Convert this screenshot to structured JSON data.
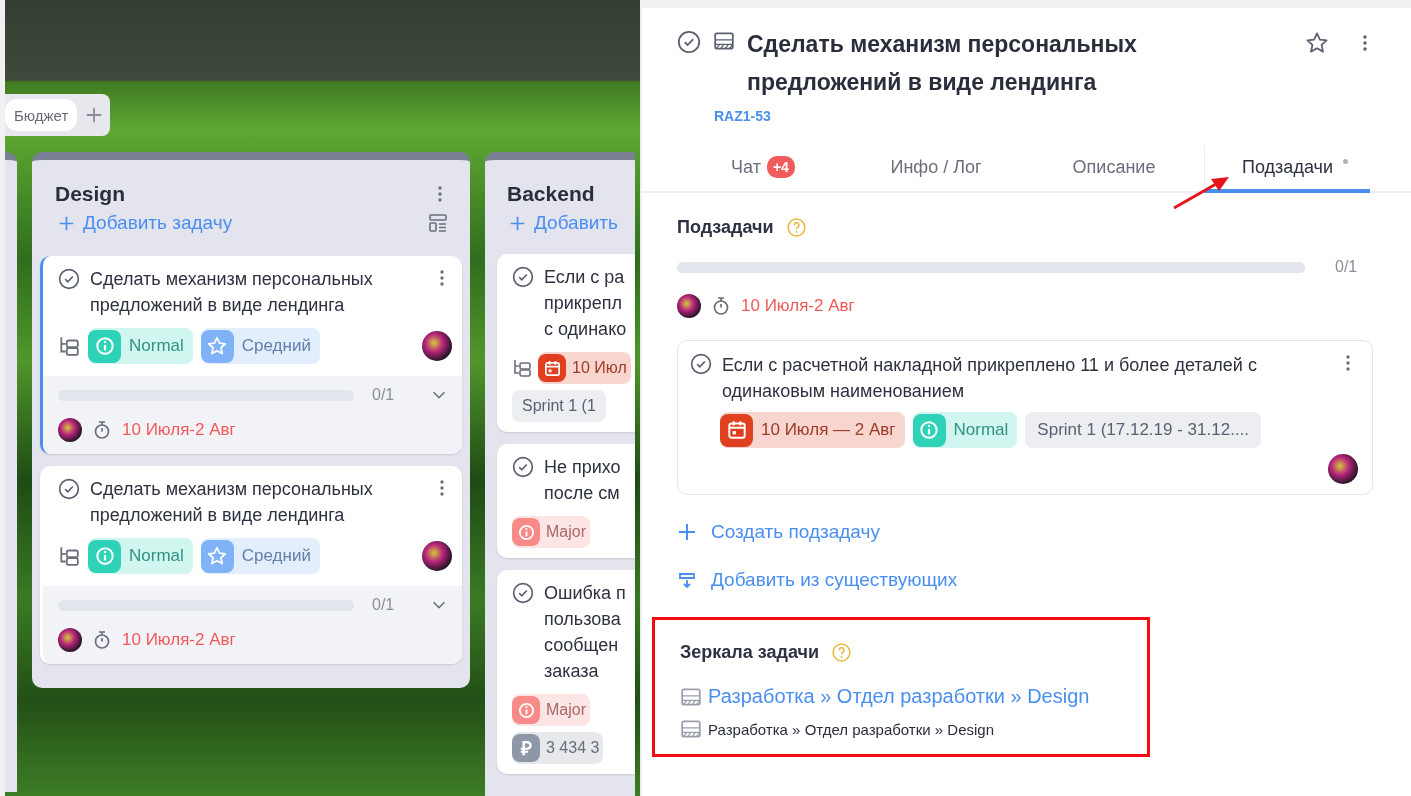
{
  "board": {
    "tabs": [
      {
        "label": "Бюджет",
        "selected": true
      }
    ],
    "columns": [
      {
        "kind": "partial"
      },
      {
        "kind": "full",
        "title": "Design",
        "add_label": "Добавить задачу",
        "cards": [
          {
            "title": "Сделать механизм персональных предложений в виде лендинга",
            "selected": true,
            "has_subtasks": true,
            "assignee": true,
            "tags": [
              {
                "kind": "priority",
                "label": "Normal",
                "color": "#2ed3b7"
              },
              {
                "kind": "importance",
                "label": "Средний",
                "color": "#7fb2f7"
              }
            ],
            "subtasks": {
              "level": 0,
              "reading": "0/1",
              "expanded": false
            },
            "due": "10 Июля-2 Авг"
          },
          {
            "title": "Сделать механизм персональных предложений в виде лендинга",
            "selected": false,
            "has_subtasks": true,
            "assignee": true,
            "tags": [
              {
                "kind": "priority",
                "label": "Normal",
                "color": "#2ed3b7"
              },
              {
                "kind": "importance",
                "label": "Средний",
                "color": "#7fb2f7"
              }
            ],
            "subtasks": {
              "level": 0,
              "reading": "0/1",
              "expanded": false
            },
            "due": "10 Июля-2 Авг"
          }
        ]
      },
      {
        "kind": "clipped",
        "title": "Backend",
        "add_label": "Добавить",
        "cards": [
          {
            "title": "Если с ра\nприкрепл\nс одинако",
            "selected": false,
            "has_subtasks": true,
            "assignee": false,
            "tags": [
              {
                "kind": "date",
                "label": "10 Июл",
                "color": "#e0401f"
              },
              {
                "kind": "sprint",
                "label": "Sprint 1 (1"
              }
            ]
          },
          {
            "title": "Не прихо\nпосле см",
            "selected": false,
            "has_subtasks": false,
            "assignee": false,
            "tags": [
              {
                "kind": "priority",
                "label": "Major",
                "color": "#f88a88"
              }
            ]
          },
          {
            "title": "Ошибка п\nпользова\nсообщен\nзаказа",
            "selected": false,
            "has_subtasks": false,
            "assignee": false,
            "tags": [
              {
                "kind": "priority",
                "label": "Major",
                "color": "#f88a88"
              },
              {
                "kind": "price",
                "symbol": "₽",
                "label": "3 434 3",
                "color": "#8e97a8"
              }
            ]
          }
        ]
      }
    ]
  },
  "task": {
    "title": "Сделать механизм персональных предложений в виде лендинга",
    "key": "RAZ1-53",
    "starred": false
  },
  "tabs": [
    {
      "label": "Чат",
      "badge": "+4",
      "selected": false,
      "dot": false,
      "pointer_arrow": false
    },
    {
      "label": "Инфо / Лог",
      "selected": false,
      "dot": false,
      "pointer_arrow": false
    },
    {
      "label": "Описание",
      "selected": false,
      "dot": false,
      "pointer_arrow": false
    },
    {
      "label": "Подзадачи",
      "selected": true,
      "dot": true,
      "pointer_arrow": true
    }
  ],
  "subtasks": {
    "heading": "Подзадачи",
    "progress": {
      "level": 0,
      "reading": "0/1"
    },
    "assignee": true,
    "due": "10 Июля-2 Авг",
    "items": [
      {
        "title": "Если с расчетной накладной прикреплено 11 и более деталей с одинаковым наименованием",
        "assignee": true,
        "tags": [
          {
            "kind": "date",
            "label": "10 Июля — 2 Авг",
            "color": "#e0401f"
          },
          {
            "kind": "priority",
            "label": "Normal",
            "color": "#2ed3b7"
          },
          {
            "kind": "sprint",
            "label": "Sprint 1 (17.12.19 - 31.12...."
          }
        ]
      }
    ],
    "actions": [
      {
        "kind": "create",
        "label": "Создать подзадачу"
      },
      {
        "kind": "add_existing",
        "label": "Добавить из существующих"
      }
    ]
  },
  "mirrors": {
    "heading": "Зеркала задачи",
    "highlighted": true,
    "items": [
      {
        "kind": "link",
        "label": "Разработка » Отдел разработки » Design"
      },
      {
        "kind": "plain",
        "label": "Разработка » Отдел разработки » Design"
      }
    ]
  }
}
